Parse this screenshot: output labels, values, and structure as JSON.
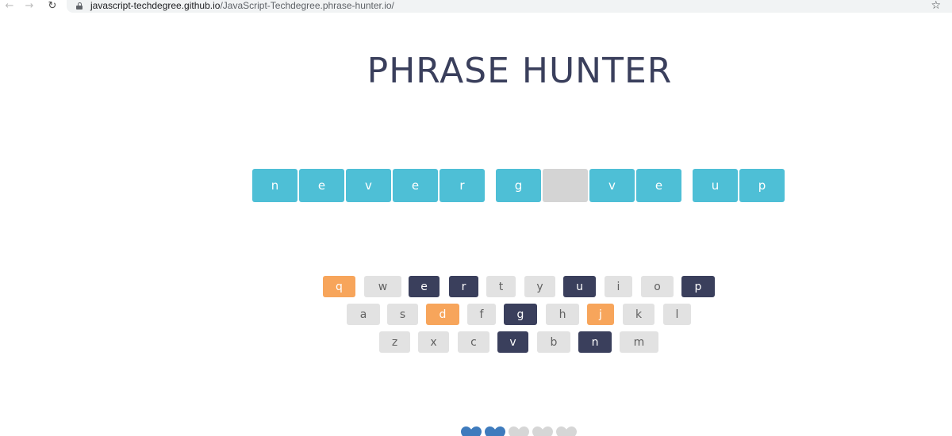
{
  "browser": {
    "url_host": "javascript-techdegree.github.io",
    "url_path": "/JavaScript-Techdegree.phrase-hunter.io/"
  },
  "game": {
    "title": "PHRASE HUNTER",
    "phrase": [
      {
        "char": "n",
        "revealed": true
      },
      {
        "char": "e",
        "revealed": true
      },
      {
        "char": "v",
        "revealed": true
      },
      {
        "char": "e",
        "revealed": true
      },
      {
        "char": "r",
        "revealed": true
      },
      {
        "char": "g",
        "revealed": true
      },
      {
        "char": "",
        "revealed": false
      },
      {
        "char": "v",
        "revealed": true
      },
      {
        "char": "e",
        "revealed": true
      },
      {
        "char": "u",
        "revealed": true
      },
      {
        "char": "p",
        "revealed": true
      }
    ],
    "keyboard": [
      [
        {
          "key": "q",
          "state": "wrong"
        },
        {
          "key": "w",
          "state": "unused"
        },
        {
          "key": "e",
          "state": "chosen"
        },
        {
          "key": "r",
          "state": "chosen"
        },
        {
          "key": "t",
          "state": "unused"
        },
        {
          "key": "y",
          "state": "unused"
        },
        {
          "key": "u",
          "state": "chosen"
        },
        {
          "key": "i",
          "state": "unused"
        },
        {
          "key": "o",
          "state": "unused"
        },
        {
          "key": "p",
          "state": "chosen"
        }
      ],
      [
        {
          "key": "a",
          "state": "unused"
        },
        {
          "key": "s",
          "state": "unused"
        },
        {
          "key": "d",
          "state": "wrong"
        },
        {
          "key": "f",
          "state": "unused"
        },
        {
          "key": "g",
          "state": "chosen"
        },
        {
          "key": "h",
          "state": "unused"
        },
        {
          "key": "j",
          "state": "wrong"
        },
        {
          "key": "k",
          "state": "unused"
        },
        {
          "key": "l",
          "state": "unused"
        }
      ],
      [
        {
          "key": "z",
          "state": "unused"
        },
        {
          "key": "x",
          "state": "unused"
        },
        {
          "key": "c",
          "state": "unused"
        },
        {
          "key": "v",
          "state": "chosen"
        },
        {
          "key": "b",
          "state": "unused"
        },
        {
          "key": "n",
          "state": "chosen"
        },
        {
          "key": "m",
          "state": "unused"
        }
      ]
    ],
    "lives": [
      {
        "state": "live"
      },
      {
        "state": "live"
      },
      {
        "state": "lost"
      },
      {
        "state": "lost"
      },
      {
        "state": "lost"
      }
    ]
  },
  "colors": {
    "letter_revealed": "#4ebfd6",
    "letter_hidden": "#d4d4d4",
    "key_unused": "#e2e2e2",
    "key_chosen": "#3a3f5c",
    "key_wrong": "#f7a55b",
    "heart_live": "#3e7bbd",
    "heart_lost": "#d6d6d6"
  },
  "icons": {
    "back": "arrow-left-icon",
    "forward": "arrow-right-icon",
    "reload": "reload-icon",
    "lock": "lock-icon",
    "bookmark": "star-icon",
    "life": "heart-icon"
  }
}
